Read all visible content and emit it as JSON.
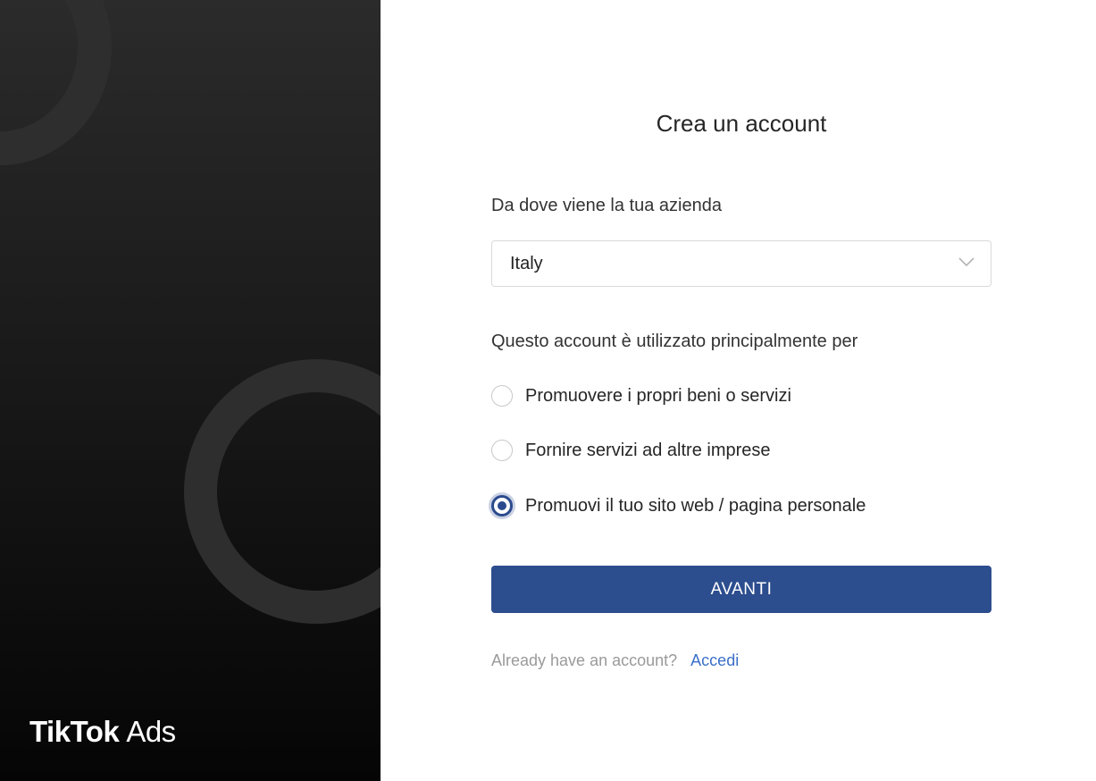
{
  "brand": {
    "name": "TikTok",
    "product": "Ads"
  },
  "form": {
    "title": "Crea un account",
    "country_label": "Da dove viene la tua azienda",
    "country_value": "Italy",
    "usage_label": "Questo account è utilizzato principalmente per",
    "options": [
      {
        "label": "Promuovere i propri beni o servizi",
        "checked": false
      },
      {
        "label": "Fornire servizi ad altre imprese",
        "checked": false
      },
      {
        "label": "Promuovi il tuo sito web / pagina personale",
        "checked": true
      }
    ],
    "submit_label": "AVANTI",
    "login_prompt": "Already have an account?",
    "login_link": "Accedi"
  },
  "colors": {
    "accent": "#2c4d8e",
    "link": "#3a6fc8",
    "panel_dark": "#1a1a1a"
  },
  "icons": {
    "select_chevron": "chevron-down-icon"
  }
}
